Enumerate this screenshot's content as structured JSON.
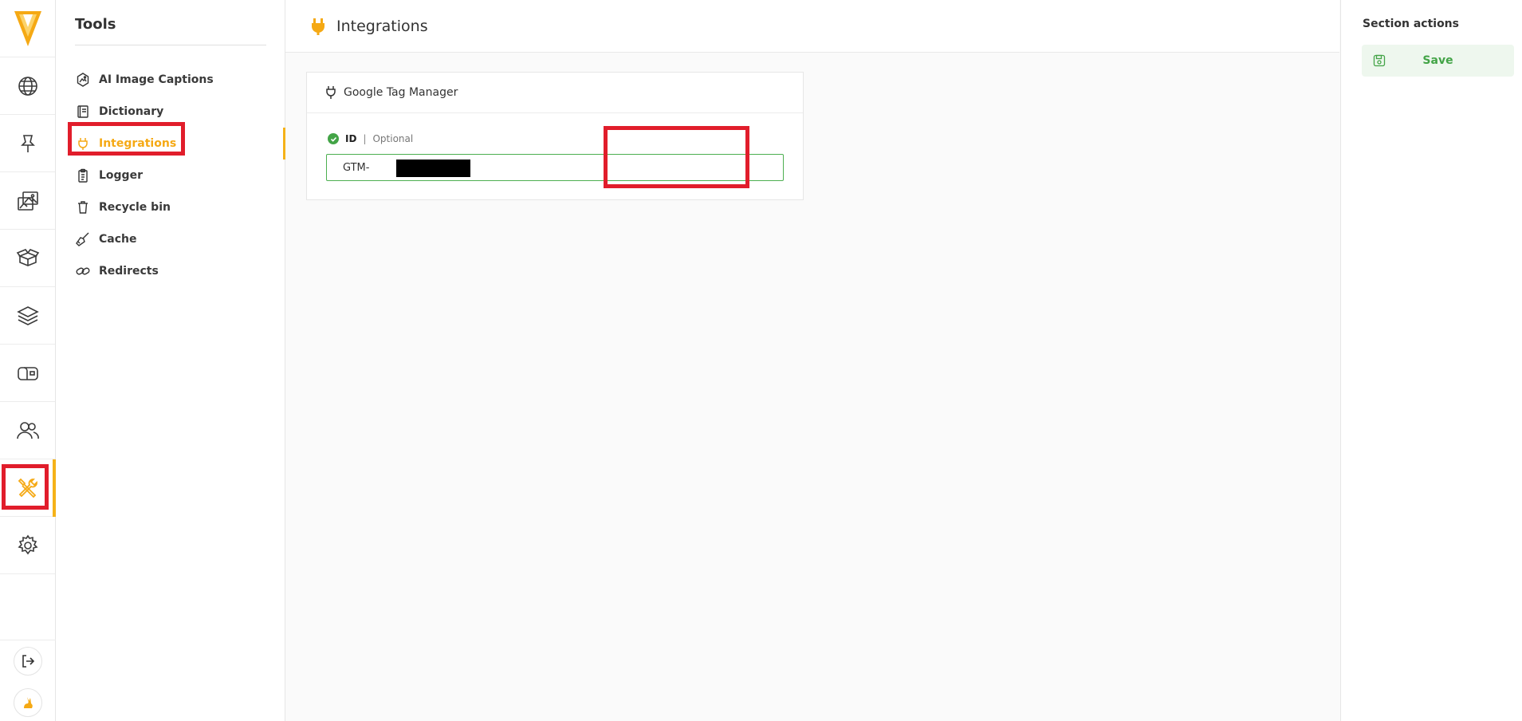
{
  "colors": {
    "accent": "#f5b219",
    "highlight": "#e11d2b",
    "success": "#43a447"
  },
  "rail": {
    "items": [
      {
        "name": "globe-icon"
      },
      {
        "name": "pin-icon"
      },
      {
        "name": "media-icon"
      },
      {
        "name": "package-icon"
      },
      {
        "name": "layers-icon"
      },
      {
        "name": "mailbox-icon"
      },
      {
        "name": "users-icon"
      },
      {
        "name": "tools-icon",
        "active": true
      },
      {
        "name": "settings-icon"
      }
    ],
    "bottom": [
      {
        "name": "logout-icon"
      },
      {
        "name": "user-avatar"
      }
    ]
  },
  "tools": {
    "title": "Tools",
    "items": [
      {
        "label": "AI Image Captions",
        "icon": "image-caption-icon"
      },
      {
        "label": "Dictionary",
        "icon": "book-icon"
      },
      {
        "label": "Integrations",
        "icon": "plug-icon",
        "active": true
      },
      {
        "label": "Logger",
        "icon": "clipboard-icon"
      },
      {
        "label": "Recycle bin",
        "icon": "trash-icon"
      },
      {
        "label": "Cache",
        "icon": "broom-icon"
      },
      {
        "label": "Redirects",
        "icon": "link-icon"
      }
    ]
  },
  "main": {
    "title": "Integrations",
    "card": {
      "title": "Google Tag Manager",
      "field": {
        "label": "ID",
        "separator": "|",
        "optional": "Optional",
        "value": "GTM-"
      }
    }
  },
  "actions": {
    "title": "Section actions",
    "save_label": "Save"
  }
}
